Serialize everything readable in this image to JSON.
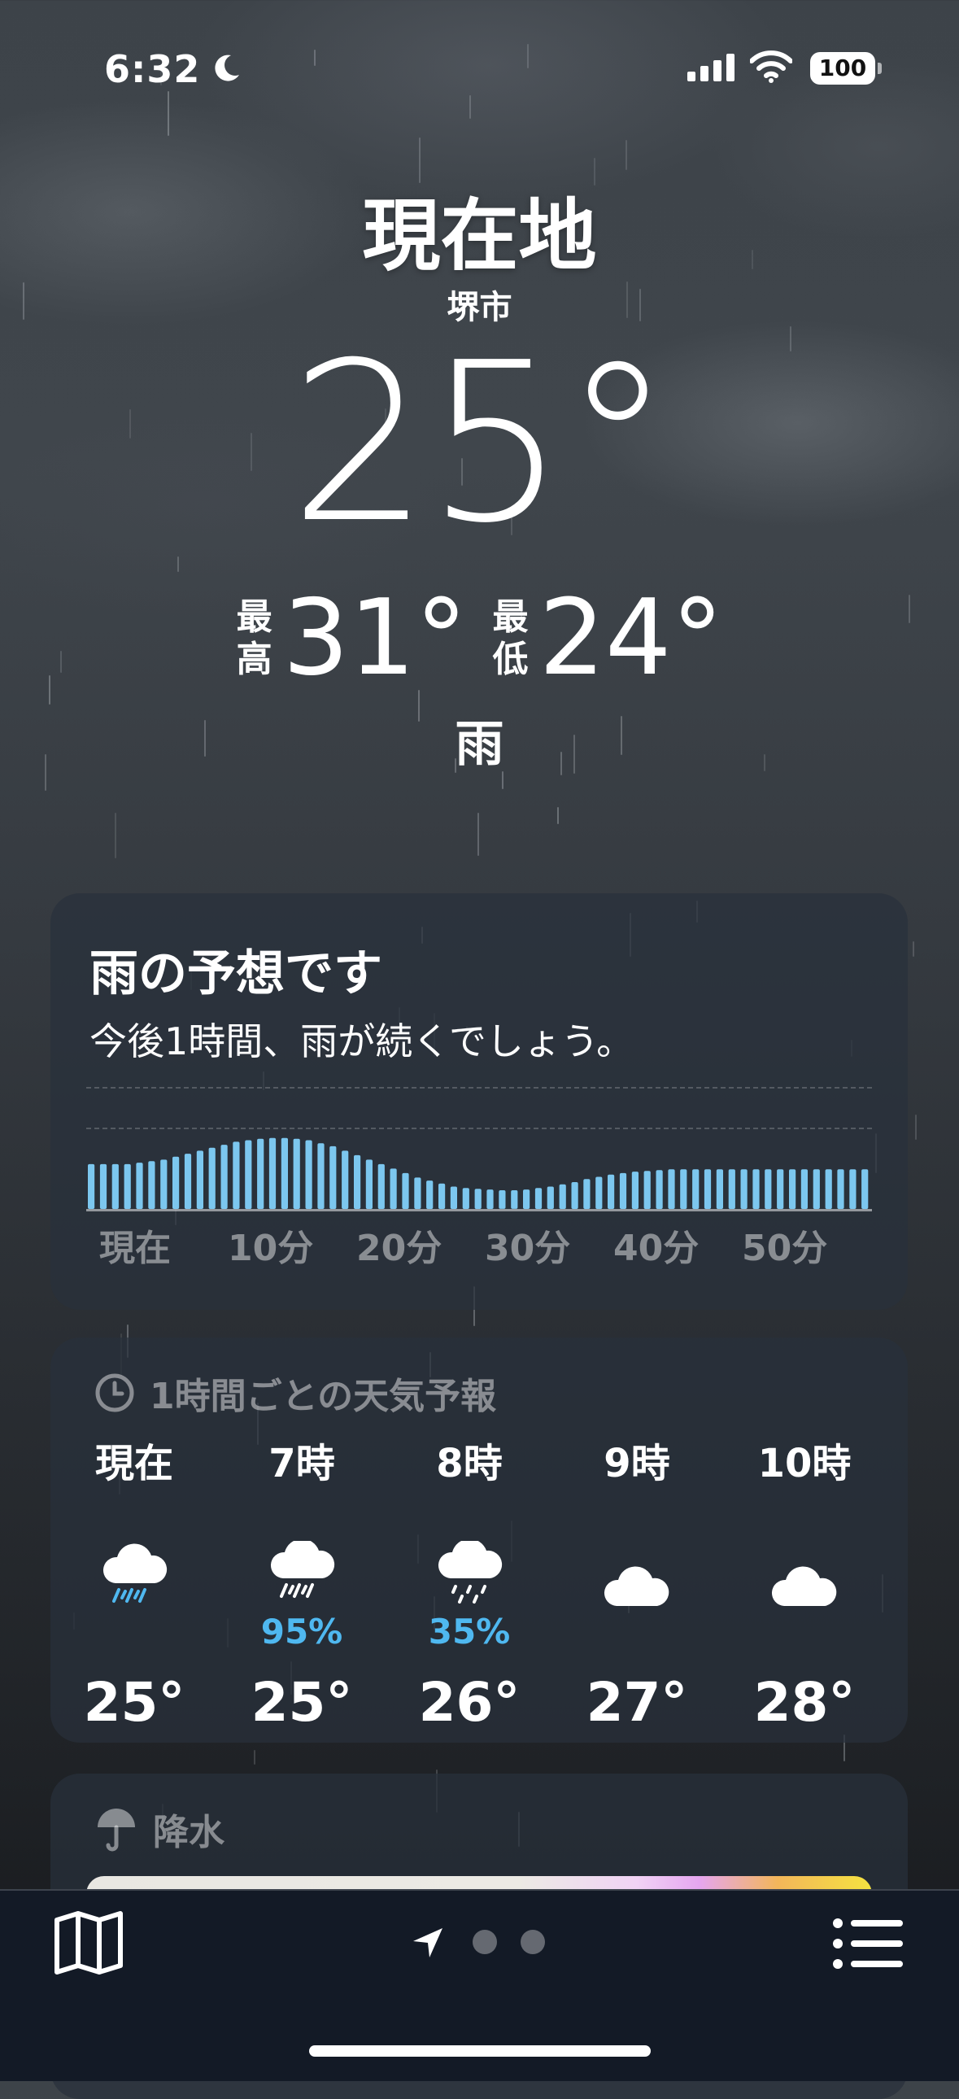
{
  "status_bar": {
    "time": "6:32",
    "battery": "100",
    "icons": [
      "moon-icon",
      "signal-icon",
      "wifi-icon",
      "battery-icon"
    ]
  },
  "header": {
    "title": "現在地",
    "city": "堺市",
    "current_temp": "25°",
    "high_label": "最高",
    "high_value": "31°",
    "low_label": "最低",
    "low_value": "24°",
    "condition": "雨"
  },
  "rain_card": {
    "title": "雨の予想です",
    "subtitle": "今後1時間、雨が続くでしょう。",
    "axis": [
      "現在",
      "10分",
      "20分",
      "30分",
      "40分",
      "50分"
    ],
    "intensity": [
      0.6,
      0.6,
      0.6,
      0.6,
      0.62,
      0.64,
      0.66,
      0.7,
      0.74,
      0.78,
      0.82,
      0.86,
      0.9,
      0.92,
      0.94,
      0.95,
      0.95,
      0.94,
      0.92,
      0.88,
      0.84,
      0.78,
      0.72,
      0.66,
      0.6,
      0.54,
      0.48,
      0.42,
      0.38,
      0.34,
      0.3,
      0.28,
      0.27,
      0.26,
      0.25,
      0.25,
      0.26,
      0.28,
      0.3,
      0.33,
      0.36,
      0.4,
      0.43,
      0.46,
      0.48,
      0.5,
      0.51,
      0.52,
      0.53,
      0.53,
      0.53,
      0.53,
      0.53,
      0.53,
      0.53,
      0.53,
      0.53,
      0.53,
      0.53,
      0.53,
      0.53,
      0.53,
      0.53,
      0.53,
      0.53
    ],
    "color": "#7cc7ef"
  },
  "hourly_card": {
    "header": "1時間ごとの天気予報",
    "hours": [
      {
        "time": "現在",
        "icon": "cloud-rain-icon",
        "pop": "",
        "temp": "25°"
      },
      {
        "time": "7時",
        "icon": "cloud-rain-icon",
        "pop": "95%",
        "temp": "25°"
      },
      {
        "time": "8時",
        "icon": "cloud-drizzle-icon",
        "pop": "35%",
        "temp": "26°"
      },
      {
        "time": "9時",
        "icon": "cloud-icon",
        "pop": "",
        "temp": "27°"
      },
      {
        "time": "10時",
        "icon": "cloud-icon",
        "pop": "",
        "temp": "28°"
      }
    ],
    "pop_color": "#4fb8f0"
  },
  "precip_card": {
    "header": "降水"
  },
  "toolbar": {
    "icons": [
      "map-icon",
      "location-arrow-icon",
      "page-dot",
      "page-dot",
      "list-icon"
    ]
  }
}
